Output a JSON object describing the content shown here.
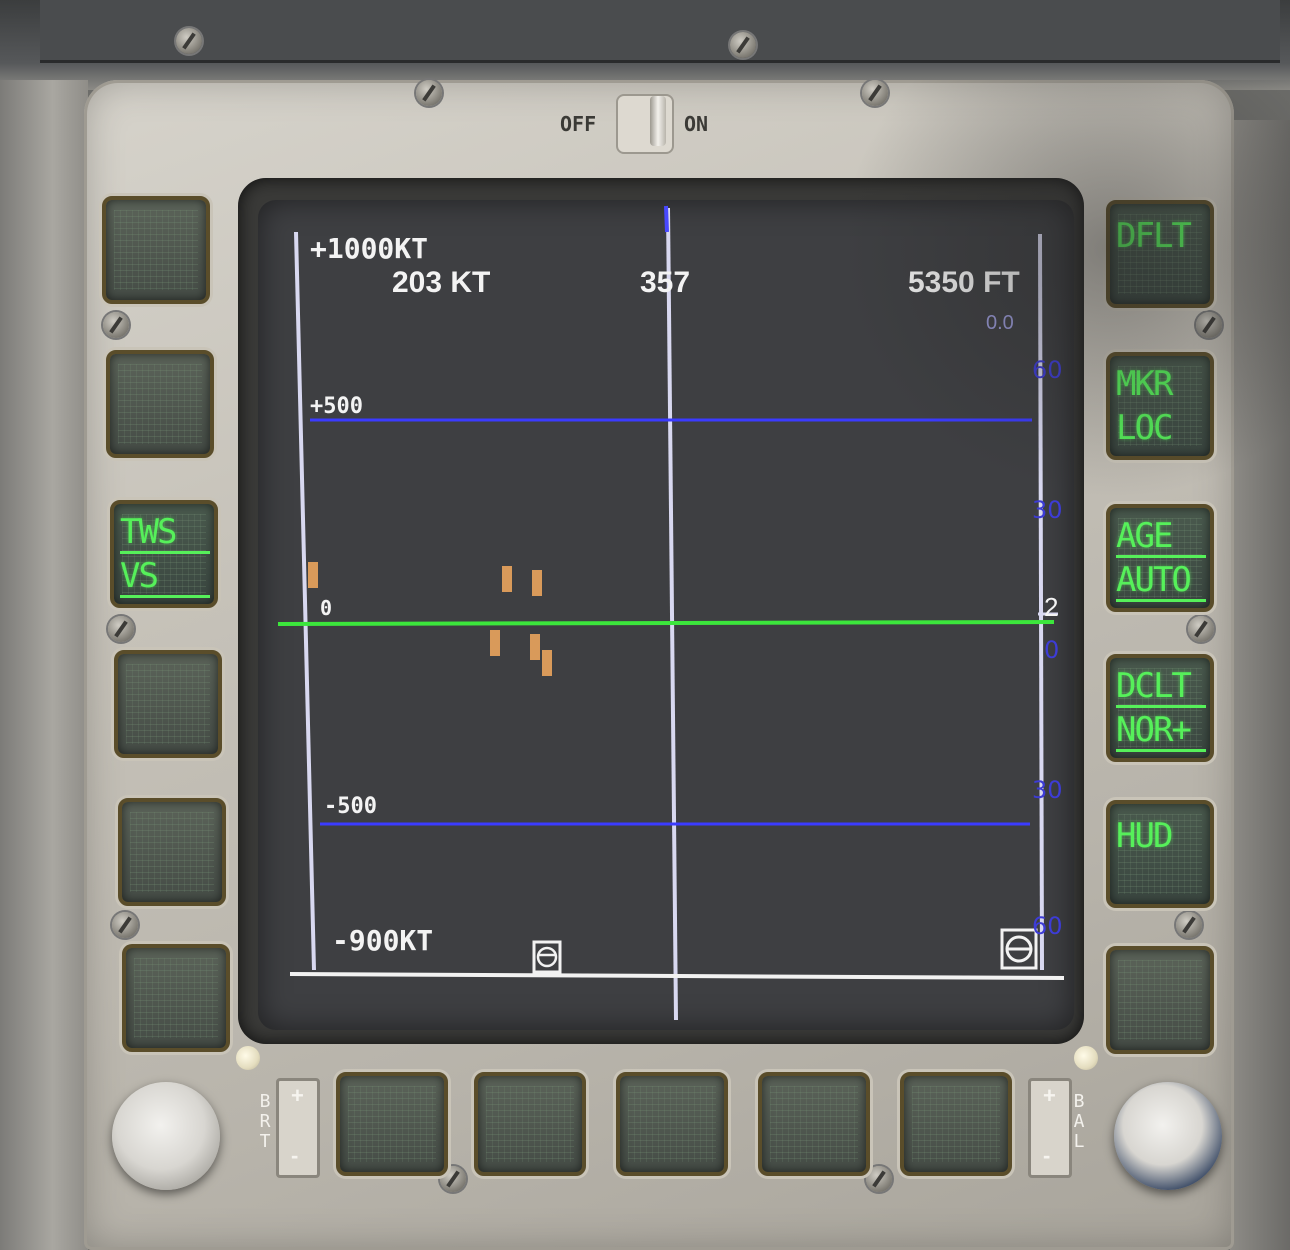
{
  "power_switch": {
    "off_label": "OFF",
    "on_label": "ON",
    "state": "ON"
  },
  "display": {
    "vel_top_label": "+1000KT",
    "vel_bottom_label": "-900KT",
    "airspeed": "203 KT",
    "heading": "357",
    "altitude": "5350 FT",
    "vertical_readout": "0.0",
    "grid_labels": {
      "plus_500": "+500",
      "zero": "0",
      "minus_500": "-500"
    },
    "right_scale": [
      "60",
      "30",
      "0",
      "30",
      "60"
    ],
    "right_marker": "2",
    "line_colors": {
      "grid": "#3b3bff",
      "horizon": "#3ce63c",
      "axis": "#d8d8f0",
      "contact": "#d99a5a"
    }
  },
  "left_buttons": [
    {
      "lines": []
    },
    {
      "lines": []
    },
    {
      "lines": [
        "TWS",
        "VS"
      ]
    },
    {
      "lines": []
    },
    {
      "lines": []
    },
    {
      "lines": []
    }
  ],
  "right_buttons": [
    {
      "lines": [
        "DFLT"
      ]
    },
    {
      "lines": [
        "MKR",
        "LOC"
      ]
    },
    {
      "lines": [
        "AGE",
        "AUTO"
      ]
    },
    {
      "lines": [
        "DCLT",
        "NOR+"
      ]
    },
    {
      "lines": [
        "HUD"
      ]
    },
    {
      "lines": []
    }
  ],
  "brightness": {
    "plus": "+",
    "minus": "-",
    "label": "BRT"
  },
  "balance": {
    "plus": "+",
    "minus": "-",
    "label": "BAL"
  }
}
